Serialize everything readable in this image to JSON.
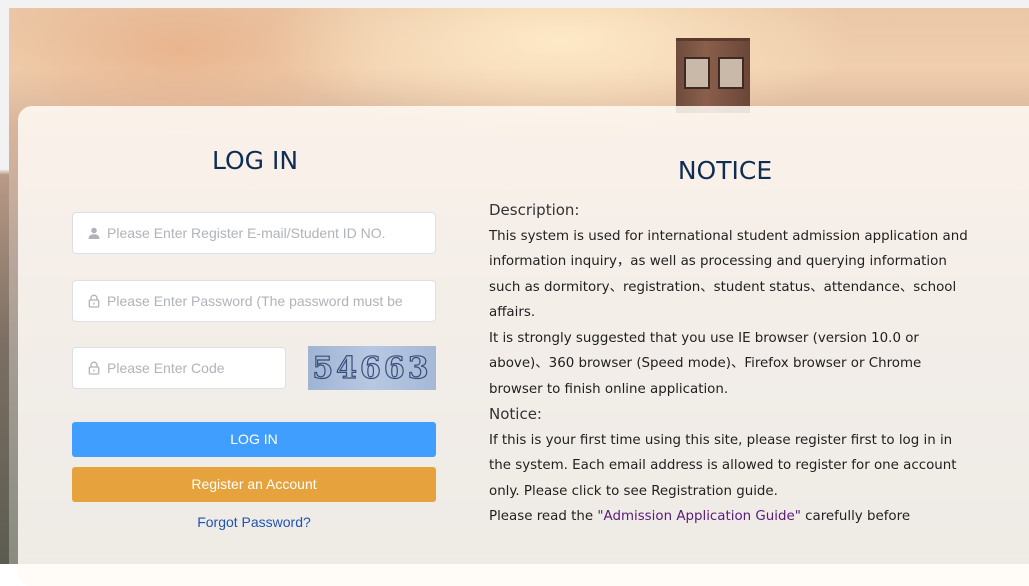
{
  "login": {
    "title": "LOG IN",
    "email_placeholder": "Please Enter Register E-mail/Student ID NO.",
    "password_placeholder": "Please Enter Password (The password must be",
    "code_placeholder": "Please Enter Code",
    "captcha_text": "54663",
    "login_button": "LOG IN",
    "register_button": "Register an Account",
    "forgot_link": "Forgot Password?"
  },
  "notice": {
    "title": "NOTICE",
    "description_heading": "Description:",
    "description_text_1": "This system is used for international student admission application and information inquiry，as well as processing and querying information such as dormitory、registration、student status、attendance、school affairs.",
    "description_text_2": "It is strongly suggested that you use IE browser (version 10.0 or above)、360 browser (Speed mode)、Firefox browser or Chrome browser to finish online application.",
    "notice_heading": "Notice:",
    "notice_text_1": "If this is your first time using this site, please register first to log in in the system. Each email address is allowed to register for one account only. Please click to see Registration guide.",
    "notice_text_2_prefix": "Please read the ",
    "notice_text_2_link": "\"Admission Application Guide\"",
    "notice_text_2_suffix": " carefully before"
  },
  "colors": {
    "login_button": "#409eff",
    "register_button": "#e6a23c",
    "title": "#0f2d52",
    "link": "#1e54b4"
  },
  "icons": {
    "email": "user-icon",
    "password": "lock-icon",
    "code": "lock-icon"
  }
}
